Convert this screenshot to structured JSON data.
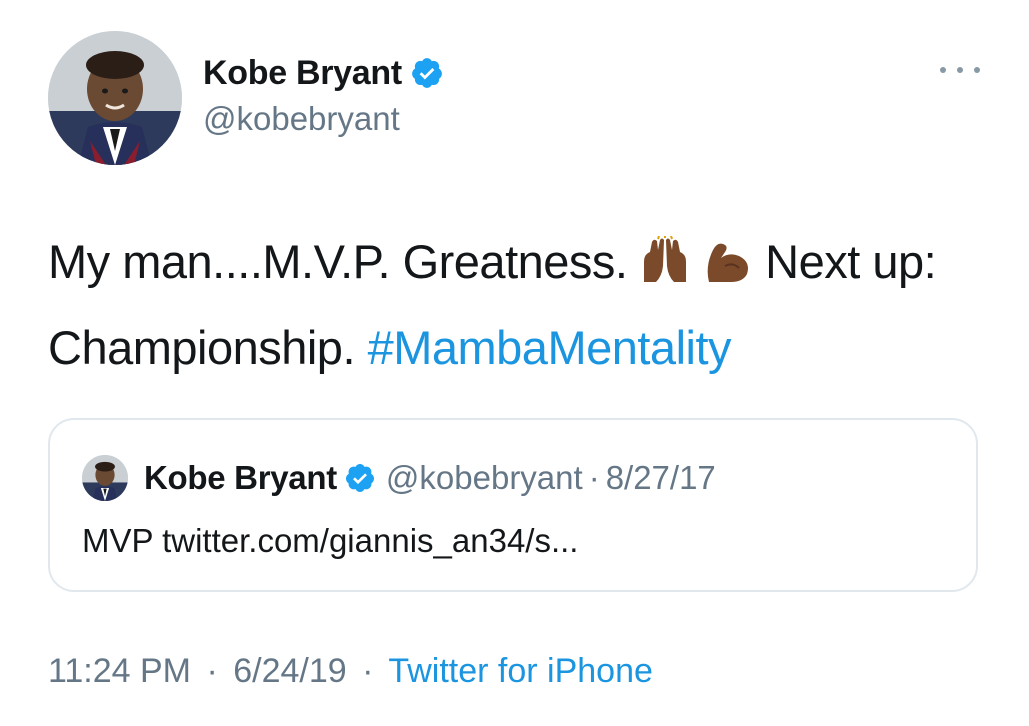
{
  "author": {
    "display_name": "Kobe Bryant",
    "handle": "@kobebryant",
    "verified": true
  },
  "tweet": {
    "text_before": "My man....M.V.P. Greatness.",
    "emojis": [
      "raised-hands-emoji",
      "flexed-biceps-emoji"
    ],
    "text_after": "Next up: Championship.",
    "hashtag": "#MambaMentality"
  },
  "quoted_tweet": {
    "display_name": "Kobe Bryant",
    "handle": "@kobebryant",
    "separator": "·",
    "date": "8/27/17",
    "text": "MVP twitter.com/giannis_an34/s..."
  },
  "footer": {
    "time": "11:24 PM",
    "separator": "·",
    "date": "6/24/19",
    "source": "Twitter for iPhone"
  },
  "colors": {
    "link": "#1b95e0",
    "verified_badge": "#1da1f2",
    "secondary_text": "#657786",
    "border": "#e1e8ed"
  }
}
